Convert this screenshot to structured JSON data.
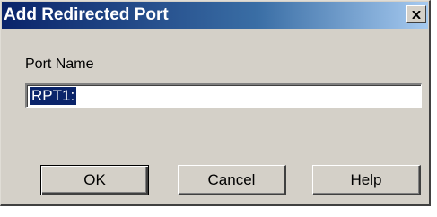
{
  "window": {
    "title": "Add Redirected Port"
  },
  "form": {
    "port_name_label": "Port Name",
    "port_name_value": "RPT1:"
  },
  "buttons": {
    "ok_label": "OK",
    "cancel_label": "Cancel",
    "help_label": "Help"
  },
  "colors": {
    "titlebar_start": "#0a246a",
    "titlebar_end": "#a6caf0",
    "dialog_face": "#d4d0c8",
    "selection": "#0a246a"
  },
  "icons": {
    "close": "close-icon"
  }
}
